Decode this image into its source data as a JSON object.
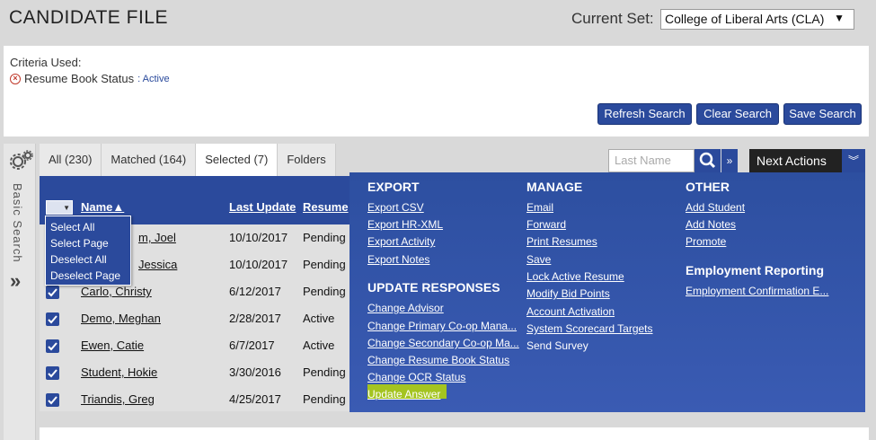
{
  "header": {
    "title": "CANDIDATE FILE",
    "current_set_label": "Current Set:",
    "current_set_value": "College of Liberal Arts (CLA)"
  },
  "criteria": {
    "label": "Criteria Used:",
    "item_label": "Resume Book Status",
    "item_value": ": Active"
  },
  "buttons": {
    "refresh": "Refresh Search",
    "clear": "Clear Search",
    "save": "Save Search"
  },
  "rail": {
    "label": "Basic Search"
  },
  "tabs": [
    {
      "label": "All (230)"
    },
    {
      "label": "Matched (164)"
    },
    {
      "label": "Selected (7)"
    },
    {
      "label": "Folders"
    }
  ],
  "search": {
    "placeholder": "Last Name"
  },
  "next_actions": {
    "label": "Next Actions"
  },
  "table": {
    "columns": [
      "Name▲",
      "Last Update",
      "Resume"
    ],
    "rows": [
      {
        "name": "m, Joel",
        "date": "10/10/2017",
        "status": "Pending"
      },
      {
        "name": "Jessica",
        "date": "10/10/2017",
        "status": "Pending"
      },
      {
        "name": "Carlo, Christy",
        "date": "6/12/2017",
        "status": "Pending"
      },
      {
        "name": "Demo, Meghan",
        "date": "2/28/2017",
        "status": "Active"
      },
      {
        "name": "Ewen, Catie",
        "date": "6/7/2017",
        "status": "Active"
      },
      {
        "name": "Student, Hokie",
        "date": "3/30/2016",
        "status": "Pending"
      },
      {
        "name": "Triandis, Greg",
        "date": "4/25/2017",
        "status": "Pending"
      }
    ]
  },
  "select_menu": {
    "options": [
      "Select All",
      "Select Page",
      "Deselect All",
      "Deselect Page"
    ]
  },
  "actions": {
    "export": {
      "title": "EXPORT",
      "items": [
        "Export CSV",
        "Export HR-XML",
        "Export Activity",
        "Export Notes"
      ]
    },
    "update": {
      "title": "UPDATE RESPONSES",
      "items": [
        "Change Advisor",
        "Change Primary Co-op Mana...",
        "Change Secondary Co-op Ma...",
        "Change Resume Book Status",
        "Change OCR Status",
        "Update Answer"
      ]
    },
    "manage": {
      "title": "MANAGE",
      "items": [
        "Email",
        "Forward",
        "Print Resumes",
        "Save",
        "Lock Active Resume",
        "Modify Bid Points",
        "Account Activation",
        "System Scorecard Targets",
        "Send Survey"
      ]
    },
    "other": {
      "title": "OTHER",
      "items": [
        "Add Student",
        "Add Notes",
        "Promote"
      ]
    },
    "employment": {
      "title": "Employment Reporting",
      "items": [
        "Employment Confirmation E..."
      ]
    }
  },
  "colors": {
    "primary": "#2b4a9c",
    "highlight": "#a4c420",
    "next_actions_bg": "#222222"
  }
}
